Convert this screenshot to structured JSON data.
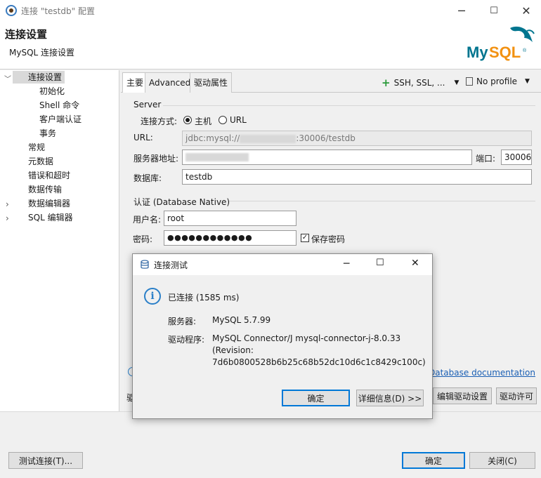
{
  "window": {
    "title": "连接 \"testdb\" 配置",
    "minimize": "─",
    "maximize": "☐",
    "close": "✕"
  },
  "header": {
    "title": "连接设置",
    "subtitle": "MySQL 连接设置",
    "logo_text": "MySQL",
    "logo_color": "#00758f",
    "logo_accent": "#f29111"
  },
  "tree": {
    "items": [
      {
        "label": "连接设置"
      },
      {
        "label": "初始化"
      },
      {
        "label": "Shell 命令"
      },
      {
        "label": "客户端认证"
      },
      {
        "label": "事务"
      },
      {
        "label": "常规"
      },
      {
        "label": "元数据"
      },
      {
        "label": "错误和超时"
      },
      {
        "label": "数据传输"
      },
      {
        "label": "数据编辑器"
      },
      {
        "label": "SQL 编辑器"
      }
    ]
  },
  "tabs": [
    {
      "label": "主要"
    },
    {
      "label": "Advanced"
    },
    {
      "label": "驱动属性"
    }
  ],
  "toolbar": {
    "ssh_label": "SSH, SSL, ...",
    "profile_label": "No profile"
  },
  "server": {
    "group_label": "Server",
    "connect_method_label": "连接方式:",
    "radio_host": "主机",
    "radio_url": "URL",
    "url_label": "URL:",
    "url_prefix": "jdbc:mysql://",
    "url_suffix": ":30006/testdb",
    "host_label": "服务器地址:",
    "port_label": "端口:",
    "port_value": "30006",
    "db_label": "数据库:",
    "db_value": "testdb"
  },
  "auth": {
    "group_label": "认证 (Database Native)",
    "user_label": "用户名:",
    "user_value": "root",
    "pwd_label": "密码:",
    "pwd_value": "●●●●●●●●●●●●",
    "save_pwd_label": "保存密码"
  },
  "content_footer": {
    "doc_link": "Database documentation",
    "edit_driver": "编辑驱动设置",
    "driver_license": "驱动许可",
    "driver_prefix": "驱"
  },
  "dialog": {
    "title": "连接测试",
    "status": "已连接 (1585 ms)",
    "server_label": "服务器:",
    "server_value": "MySQL 5.7.99",
    "driver_label": "驱动程序:",
    "driver_line1": "MySQL Connector/J mysql-connector-j-8.0.33",
    "driver_line2": "(Revision:",
    "driver_line3": "7d6b0800528b6b25c68b52dc10d6c1c8429c100c)",
    "ok": "确定",
    "details": "详细信息(D) >>"
  },
  "footer": {
    "test_btn": "测试连接(T)...",
    "ok_btn": "确定",
    "close_btn": "关闭(C)"
  }
}
